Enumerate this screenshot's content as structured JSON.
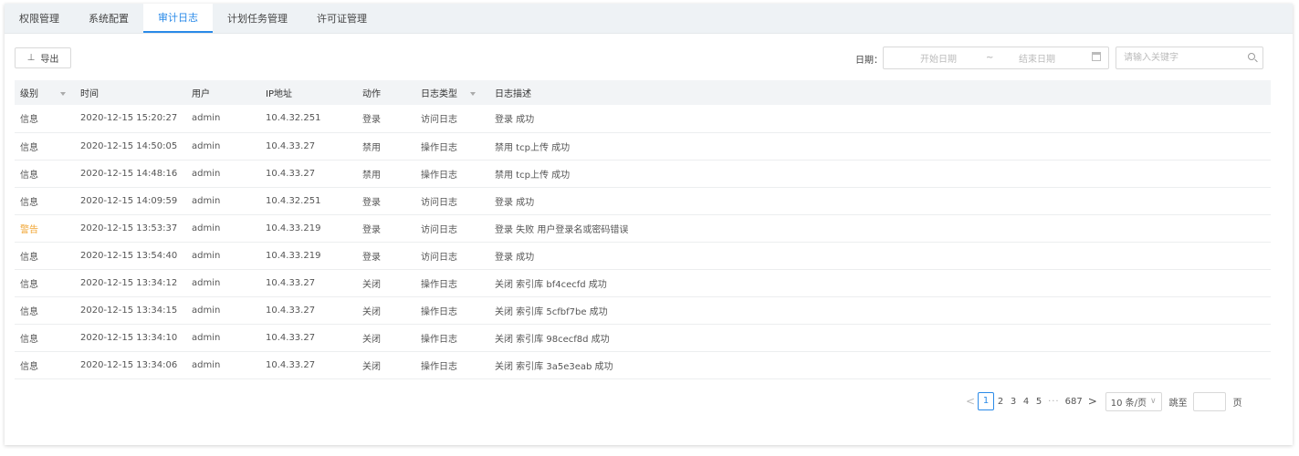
{
  "tabs": [
    "权限管理",
    "系统配置",
    "审计日志",
    "计划任务管理",
    "许可证管理"
  ],
  "active_tab": 2,
  "toolbar": {
    "export_label": "导出",
    "date_label": "日期：",
    "start_placeholder": "开始日期",
    "range_separator": "~",
    "end_placeholder": "结束日期",
    "search_placeholder": "请输入关键字"
  },
  "table": {
    "headers": [
      "级别",
      "时间",
      "用户",
      "IP地址",
      "动作",
      "日志类型",
      "日志描述"
    ],
    "rows": [
      {
        "level": "信息",
        "time": "2020-12-15 15:20:27",
        "user": "admin",
        "ip": "10.4.32.251",
        "action": "登录",
        "type": "访问日志",
        "desc": "登录 成功"
      },
      {
        "level": "信息",
        "time": "2020-12-15 14:50:05",
        "user": "admin",
        "ip": "10.4.33.27",
        "action": "禁用",
        "type": "操作日志",
        "desc": "禁用 tcp上传 成功"
      },
      {
        "level": "信息",
        "time": "2020-12-15 14:48:16",
        "user": "admin",
        "ip": "10.4.33.27",
        "action": "禁用",
        "type": "操作日志",
        "desc": "禁用 tcp上传 成功"
      },
      {
        "level": "信息",
        "time": "2020-12-15 14:09:59",
        "user": "admin",
        "ip": "10.4.32.251",
        "action": "登录",
        "type": "访问日志",
        "desc": "登录 成功"
      },
      {
        "level": "警告",
        "time": "2020-12-15 13:53:37",
        "user": "admin",
        "ip": "10.4.33.219",
        "action": "登录",
        "type": "访问日志",
        "desc": "登录 失败 用户登录名或密码错误"
      },
      {
        "level": "信息",
        "time": "2020-12-15 13:54:40",
        "user": "admin",
        "ip": "10.4.33.219",
        "action": "登录",
        "type": "访问日志",
        "desc": "登录 成功"
      },
      {
        "level": "信息",
        "time": "2020-12-15 13:34:12",
        "user": "admin",
        "ip": "10.4.33.27",
        "action": "关闭",
        "type": "操作日志",
        "desc": "关闭 索引库 bf4cecfd 成功"
      },
      {
        "level": "信息",
        "time": "2020-12-15 13:34:15",
        "user": "admin",
        "ip": "10.4.33.27",
        "action": "关闭",
        "type": "操作日志",
        "desc": "关闭 索引库 5cfbf7be 成功"
      },
      {
        "level": "信息",
        "time": "2020-12-15 13:34:10",
        "user": "admin",
        "ip": "10.4.33.27",
        "action": "关闭",
        "type": "操作日志",
        "desc": "关闭 索引库 98cecf8d 成功"
      },
      {
        "level": "信息",
        "time": "2020-12-15 13:34:06",
        "user": "admin",
        "ip": "10.4.33.27",
        "action": "关闭",
        "type": "操作日志",
        "desc": "关闭 索引库 3a5e3eab 成功"
      }
    ]
  },
  "pagination": {
    "prev": "<",
    "pages": [
      "1",
      "2",
      "3",
      "4",
      "5"
    ],
    "active_page": "1",
    "ellipsis": "···",
    "last_page": "687",
    "next": ">",
    "page_size": "10 条/页",
    "jump_label": "跳至",
    "page_suffix": "页"
  },
  "colors": {
    "accent": "#2a8ae8",
    "warning": "#f0a431",
    "tab_bar": "#eef2f5",
    "header_row": "#f2f4f6"
  },
  "icons": {
    "export": "upload-icon",
    "calendar": "calendar-icon",
    "search": "search-icon",
    "filter": "filter-icon"
  }
}
